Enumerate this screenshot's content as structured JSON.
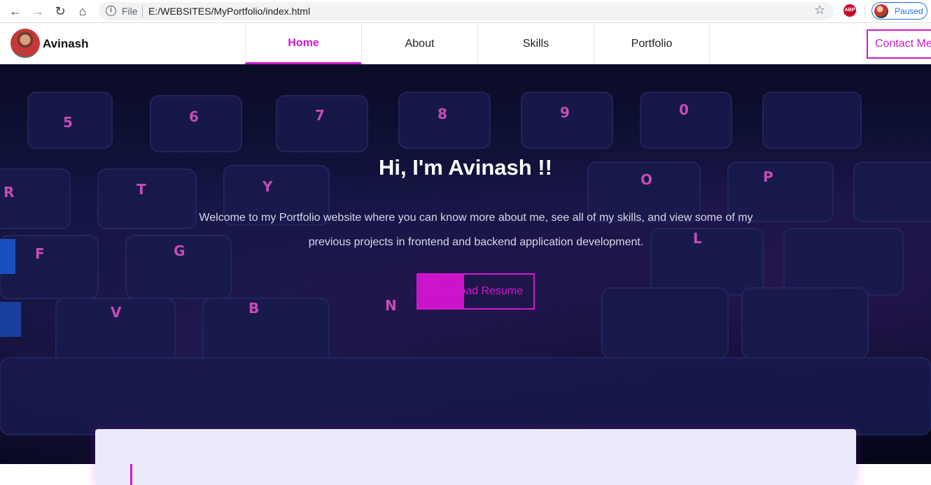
{
  "browser": {
    "file_label": "File",
    "url": "E:/WEBSITES/MyPortfolio/index.html",
    "info_glyph": "i",
    "star_glyph": "☆",
    "abp_label": "ABP",
    "profile_status": "Paused",
    "icons": [
      "back-icon",
      "forward-icon",
      "reload-icon",
      "home-icon",
      "info-icon",
      "star-icon",
      "adblock-icon",
      "profile-avatar"
    ]
  },
  "nav": {
    "brand_name": "Avinash",
    "menu": [
      {
        "label": "Home",
        "active": true
      },
      {
        "label": "About",
        "active": false
      },
      {
        "label": "Skills",
        "active": false
      },
      {
        "label": "Portfolio",
        "active": false
      }
    ],
    "contact_label": "Contact Me"
  },
  "hero": {
    "title": "Hi, I'm Avinash !!",
    "subtitle": "Welcome to my Portfolio website where you can know more about me, see all of my skills, and view some of my previous projects in frontend and backend application development.",
    "resume_label": "Download Resume"
  },
  "colors": {
    "accent": "#d118d1",
    "hero_bg": "#15184a",
    "card_bg": "#ebe9fc",
    "browser_blue": "#1a73e8"
  }
}
